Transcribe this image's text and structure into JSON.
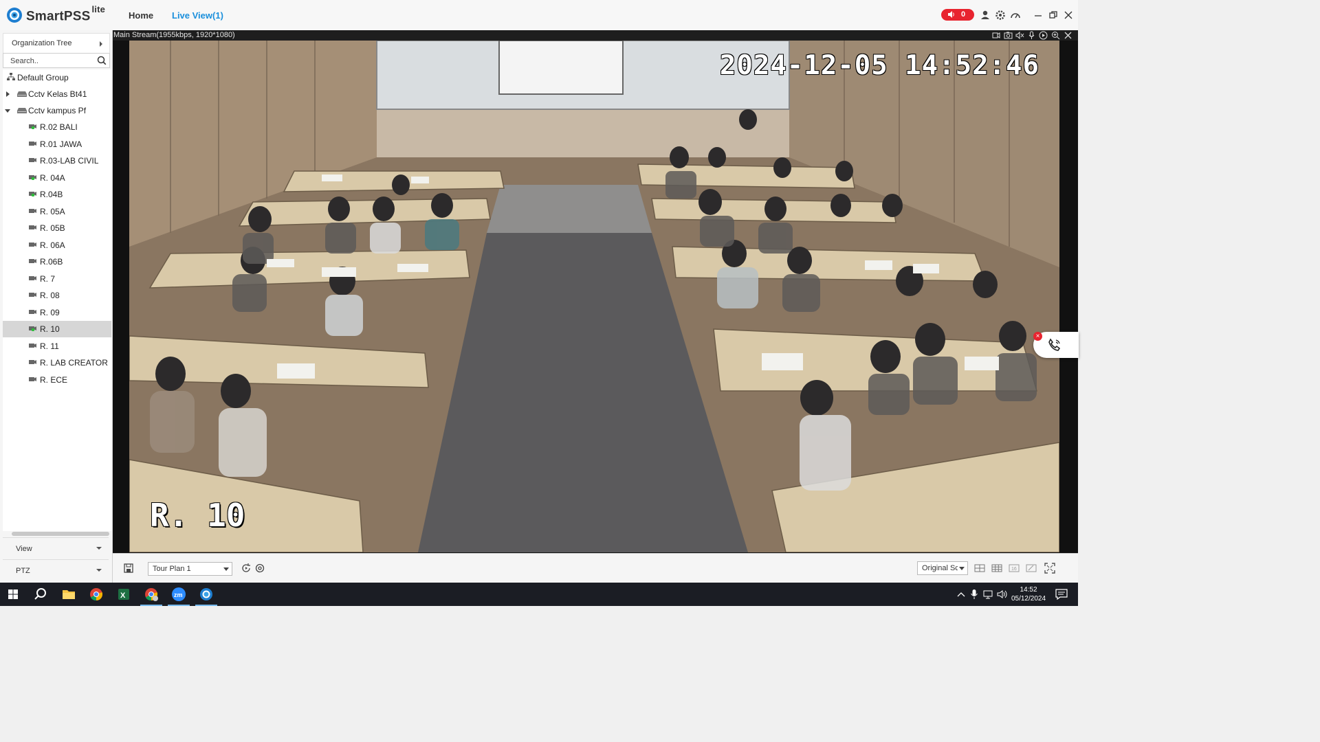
{
  "app": {
    "name": "SmartPSS",
    "edition": "lite",
    "colors": {
      "accent": "#1a8fdc",
      "alarm": "#e8242f",
      "taskbar": "#1b1d24"
    }
  },
  "nav": {
    "tabs": [
      {
        "label": "Home"
      },
      {
        "label": "Live View(1)",
        "active": true
      }
    ]
  },
  "titlebar": {
    "alarm_count": "0",
    "icons": [
      "speaker-icon",
      "user-icon",
      "settings-gear-icon",
      "performance-gauge-icon",
      "minimize-icon",
      "restore-icon",
      "close-icon"
    ]
  },
  "sidebar": {
    "header": "Organization Tree",
    "search_placeholder": "Search..",
    "tree": {
      "root": "Default Group",
      "groups": [
        {
          "label": "Cctv Kelas Bt41",
          "expanded": false
        },
        {
          "label": "Cctv kampus Pf",
          "expanded": true,
          "devices": [
            {
              "label": "R.02 BALI",
              "online": true
            },
            {
              "label": "R.01 JAWA",
              "online": false
            },
            {
              "label": "R.03-LAB CIVIL",
              "online": false
            },
            {
              "label": "R. 04A",
              "online": true
            },
            {
              "label": "R.04B",
              "online": true
            },
            {
              "label": "R. 05A",
              "online": false
            },
            {
              "label": "R. 05B",
              "online": false
            },
            {
              "label": "R. 06A",
              "online": false
            },
            {
              "label": "R.06B",
              "online": false
            },
            {
              "label": "R. 7",
              "online": false
            },
            {
              "label": "R. 08",
              "online": false
            },
            {
              "label": "R. 09",
              "online": false
            },
            {
              "label": "R. 10",
              "online": true,
              "selected": true
            },
            {
              "label": "R. 11",
              "online": false
            },
            {
              "label": "R. LAB CREATOR",
              "online": false
            },
            {
              "label": "R. ECE",
              "online": false
            }
          ]
        }
      ]
    },
    "sections": [
      {
        "label": "View"
      },
      {
        "label": "PTZ"
      }
    ]
  },
  "video": {
    "stream_info": "Main Stream(1955kbps, 1920*1080)",
    "osd_timestamp": "2024-12-05 14:52:46",
    "osd_channel_name": "R. 10",
    "toolbar_icons": [
      "audio-talk-icon",
      "snapshot-icon",
      "audio-mute-icon",
      "microphone-icon",
      "playback-icon",
      "zoom-icon",
      "close-icon"
    ]
  },
  "controls": {
    "tour_plan": "Tour Plan 1",
    "aspect_ratio": "Original Sca",
    "icons": [
      "save-view-icon",
      "tour-play-icon",
      "tour-settings-icon",
      "layout-4-icon",
      "layout-9-icon",
      "layout-16-icon",
      "custom-layout-icon",
      "fullscreen-icon"
    ]
  },
  "taskbar": {
    "time": "14:52",
    "date": "05/12/2024",
    "apps": [
      "windows-start-icon",
      "search-icon",
      "file-explorer-icon",
      "chrome-icon",
      "excel-icon",
      "chrome-profile-icon",
      "zoom-app-icon",
      "smartpss-icon"
    ]
  }
}
